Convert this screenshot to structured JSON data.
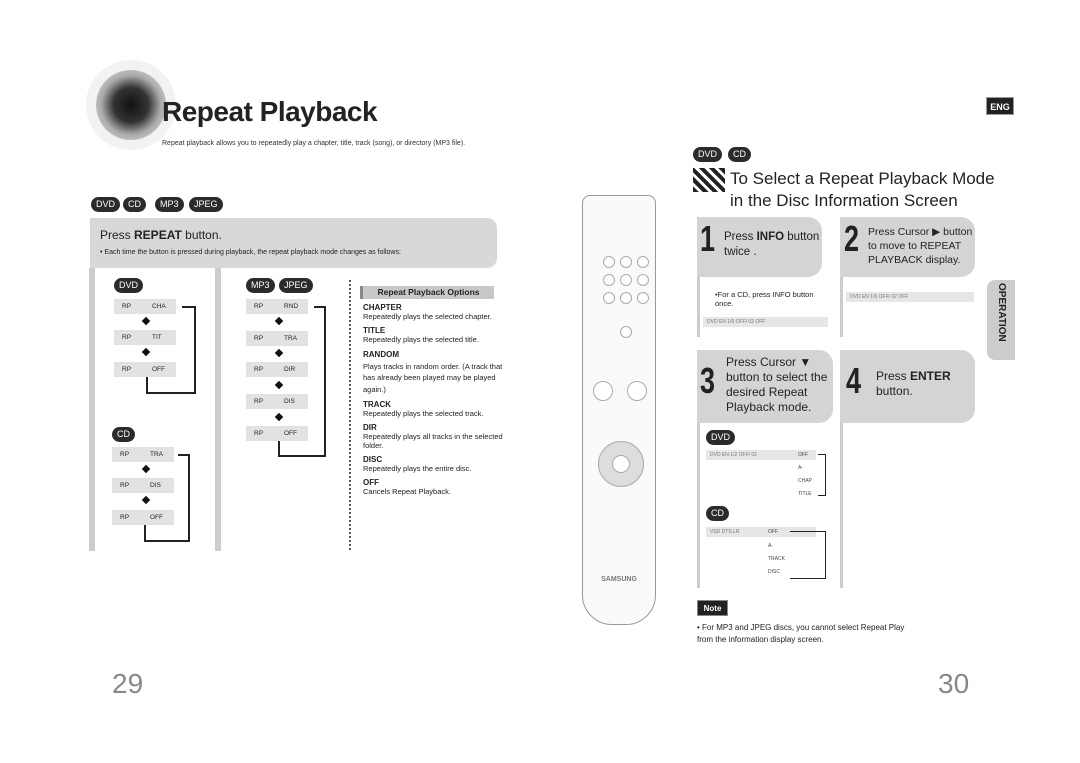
{
  "header": {
    "title": "Repeat Playback",
    "subtitle": "Repeat playback allows you to repeatedly play a chapter, title, track (song), or directory (MP3 file).",
    "lang_badge": "ENG"
  },
  "left": {
    "disc_badges": [
      "DVD",
      "CD",
      "MP3",
      "JPEG"
    ],
    "instruction": {
      "prefix": "Press ",
      "bold": "REPEAT",
      "suffix": " button."
    },
    "bullet": "• Each time the button is pressed during playback, the repeat playback mode changes as follows:",
    "dvd": {
      "badge": "DVD",
      "rows": [
        [
          "RP",
          "CHA"
        ],
        [
          "RP",
          "TIT"
        ],
        [
          "RP",
          "OFF"
        ]
      ]
    },
    "cd": {
      "badge": "CD",
      "rows": [
        [
          "RP",
          "TRA"
        ],
        [
          "RP",
          "DIS"
        ],
        [
          "RP",
          "OFF"
        ]
      ]
    },
    "mp3": {
      "badges": [
        "MP3",
        "JPEG"
      ],
      "rows": [
        [
          "RP",
          "RND"
        ],
        [
          "RP",
          "TRA"
        ],
        [
          "RP",
          "DIR"
        ],
        [
          "RP",
          "DIS"
        ],
        [
          "RP",
          "OFF"
        ]
      ]
    },
    "options": {
      "header": "Repeat Playback Options",
      "items": [
        {
          "name": "CHAPTER",
          "desc": "Repeatedly plays the selected chapter."
        },
        {
          "name": "TITLE",
          "desc": "Repeatedly plays the selected title."
        },
        {
          "name": "RANDOM",
          "desc": "Plays tracks in random order. (A track that has already been played may be played again.)"
        },
        {
          "name": "TRACK",
          "desc": "Repeatedly plays the selected track."
        },
        {
          "name": "DIR",
          "desc": "Repeatedly plays all tracks in the selected folder."
        },
        {
          "name": "DISC",
          "desc": "Repeatedly plays the entire disc."
        },
        {
          "name": "OFF",
          "desc": "Cancels Repeat Playback."
        }
      ]
    }
  },
  "remote": {
    "brand": "SAMSUNG"
  },
  "right": {
    "disc_badges": [
      "DVD",
      "CD"
    ],
    "heading_line1": "To Select a Repeat Playback Mode",
    "heading_line2": "in the Disc Information Screen",
    "steps": [
      {
        "num": "1",
        "pre": "Press ",
        "bold": "INFO",
        "post": " button twice .",
        "note": "•For a CD, press INFO button once.",
        "display": "DVD  EN 1/6  OFF/ 02  OFF"
      },
      {
        "num": "2",
        "text": "Press Cursor ▶ button to move to REPEAT PLAYBACK display.",
        "display": "DVD  EN 1/6  OFF/ 02  OFF"
      },
      {
        "num": "3",
        "text": "Press Cursor ▼ button to select the desired Repeat Playback mode.",
        "dvd_badge": "DVD",
        "dvd_modes": [
          "OFF",
          "A-",
          "CHAP",
          "TITLE"
        ],
        "cd_badge": "CD",
        "cd_modes": [
          "OFF",
          "A-",
          "TRACK",
          "DISC"
        ],
        "dvd_display": "DVD  EN 1/2  OFF/ 02",
        "cd_display": "VSD  DTS  LR"
      },
      {
        "num": "4",
        "pre": "Press ",
        "bold": "ENTER",
        "post": " button."
      }
    ],
    "side_tab": "OPERATION",
    "note_label": "Note",
    "note_text": "• For MP3 and JPEG discs, you cannot select Repeat Play from the information display screen."
  },
  "pages": {
    "left": "29",
    "right": "30"
  }
}
